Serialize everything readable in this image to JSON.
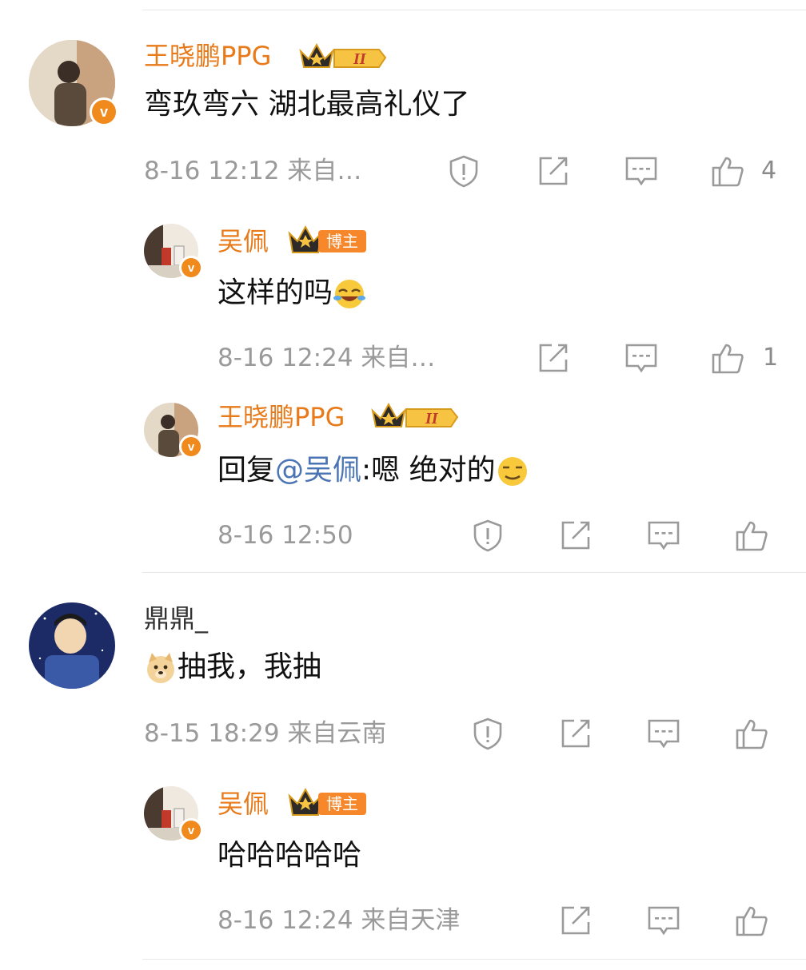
{
  "colors": {
    "accent": "#e87a1a",
    "mention": "#4a74b4",
    "meta": "#9a9a9a"
  },
  "comments": [
    {
      "user": "王晓鹏PPG",
      "badge_numeral": "II",
      "content": "弯玖弯六 湖北最高礼仪了",
      "time": "8-16 12:12",
      "source": "来自…",
      "likes": "4",
      "replies": [
        {
          "user": "吴佩",
          "badge_label": "博主",
          "content": "这样的吗",
          "emoji": "laugh-cry-emoji",
          "time": "8-16 12:24",
          "source": "来自…",
          "likes": "1"
        },
        {
          "user": "王晓鹏PPG",
          "badge_numeral": "II",
          "reply_prefix": "回复",
          "mention": "@吴佩",
          "content": ":嗯 绝对的",
          "emoji": "smirk-emoji",
          "time": "8-16 12:50",
          "source": ""
        }
      ]
    },
    {
      "user": "鼎鼎_",
      "content": "抽我，我抽",
      "emoji": "doge-emoji",
      "time": "8-15 18:29",
      "source": "来自云南",
      "replies": [
        {
          "user": "吴佩",
          "badge_label": "博主",
          "content": "哈哈哈哈哈",
          "time": "8-16 12:24",
          "source": "来自天津"
        }
      ]
    }
  ],
  "icons": {
    "report": "report-icon",
    "repost": "repost-icon",
    "comment": "comment-icon",
    "like": "like-icon"
  }
}
